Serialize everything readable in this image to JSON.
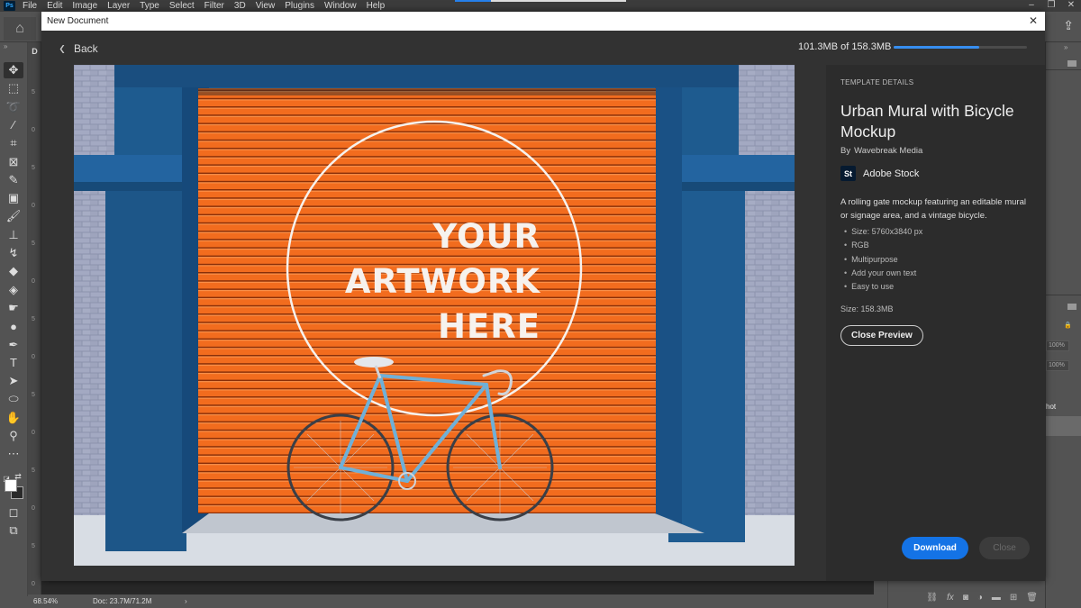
{
  "menubar": {
    "app_icon": "Ps",
    "items": [
      "File",
      "Edit",
      "Image",
      "Layer",
      "Type",
      "Select",
      "Filter",
      "3D",
      "View",
      "Plugins",
      "Window",
      "Help"
    ],
    "window_controls": [
      "minimize-icon",
      "restore-icon",
      "close-icon"
    ]
  },
  "options_bar": {
    "home_icon": "home-icon",
    "share_icon": "share-icon"
  },
  "toolbar": {
    "tools": [
      {
        "name": "move-tool",
        "glyph": "✥"
      },
      {
        "name": "marquee-tool",
        "glyph": "⬚"
      },
      {
        "name": "lasso-tool",
        "glyph": "➰"
      },
      {
        "name": "magic-wand-tool",
        "glyph": "⁄"
      },
      {
        "name": "crop-tool",
        "glyph": "⌗"
      },
      {
        "name": "frame-tool",
        "glyph": "⊠"
      },
      {
        "name": "eyedropper-tool",
        "glyph": "✎"
      },
      {
        "name": "healing-tool",
        "glyph": "▣"
      },
      {
        "name": "brush-tool",
        "glyph": "🖌"
      },
      {
        "name": "stamp-tool",
        "glyph": "⊥"
      },
      {
        "name": "history-brush-tool",
        "glyph": "↯"
      },
      {
        "name": "eraser-tool",
        "glyph": "◆"
      },
      {
        "name": "paint-bucket-tool",
        "glyph": "◈"
      },
      {
        "name": "smudge-tool",
        "glyph": "☛"
      },
      {
        "name": "dodge-tool",
        "glyph": "●"
      },
      {
        "name": "pen-tool",
        "glyph": "✒"
      },
      {
        "name": "type-tool",
        "glyph": "T"
      },
      {
        "name": "path-selection-tool",
        "glyph": "➤"
      },
      {
        "name": "ellipse-tool",
        "glyph": "⬭"
      },
      {
        "name": "hand-tool",
        "glyph": "✋"
      },
      {
        "name": "zoom-tool",
        "glyph": "⚲"
      },
      {
        "name": "more-tools",
        "glyph": "⋯"
      }
    ],
    "quick_mask_glyph": "◻",
    "screen_mode_glyph": "⧉"
  },
  "ruler": {
    "tab_label": "D",
    "numbers": [
      "5",
      "0",
      "5",
      "0",
      "5",
      "0",
      "5",
      "0",
      "5",
      "0",
      "5",
      "0",
      "5",
      "0"
    ]
  },
  "statusbar": {
    "zoom": "68.54%",
    "doc": "Doc: 23.7M/71.2M",
    "arrow": "›"
  },
  "right_panel": {
    "opacity_1": "100%",
    "opacity_2": "100%",
    "layer_name_fragment": "hot"
  },
  "layers_footer_icons": [
    "link-icon",
    "fx-icon",
    "mask-icon",
    "adjustment-icon",
    "folder-icon",
    "new-layer-icon",
    "trash-icon"
  ],
  "modal": {
    "title": "New Document",
    "back_label": "Back",
    "download_progress_text": "101.3MB of 158.3MB",
    "download_progress_fraction": 0.64,
    "preview": {
      "artwork_lines": [
        "YOUR",
        "ARTWORK",
        "HERE"
      ]
    },
    "details": {
      "section_label": "TEMPLATE DETAILS",
      "title": "Urban Mural with Bicycle Mockup",
      "by_label": "By",
      "author": "Wavebreak Media",
      "source_badge": "St",
      "source_name": "Adobe Stock",
      "description": "A rolling gate mockup featuring an editable mural or signage area, and a vintage bicycle.",
      "features": [
        "Size: 5760x3840 px",
        "RGB",
        "Multipurpose",
        "Add your own text",
        "Easy to use"
      ],
      "size_text": "Size:  158.3MB",
      "close_preview_label": "Close Preview",
      "download_label": "Download",
      "close_label": "Close"
    }
  },
  "colors": {
    "accent_blue": "#1473e6",
    "progress_blue": "#378ef0",
    "gate_orange": "#f06a1c",
    "wall_blue": "#1d5a8e"
  }
}
